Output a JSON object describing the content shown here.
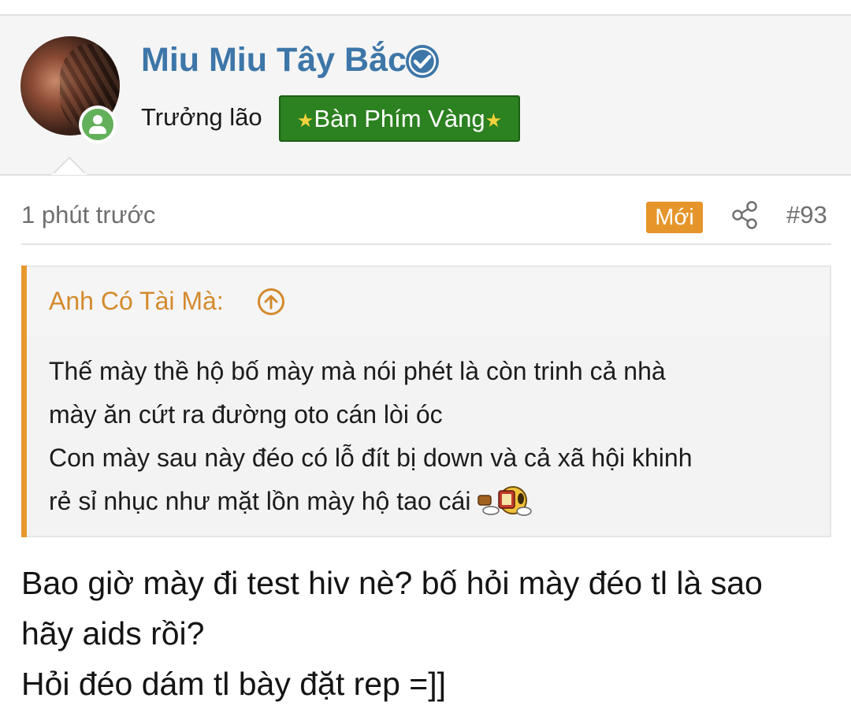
{
  "user": {
    "name": "Miu Miu Tây Bắc",
    "title": "Trưởng lão",
    "banner": "Bàn Phím Vàng",
    "banner_star": "★",
    "verified_icon": "verified-check-icon",
    "status_icon": "online-user-icon"
  },
  "post": {
    "time": "1 phút trước",
    "new_badge": "Mới",
    "share_icon": "share-icon",
    "number": "#93"
  },
  "quote": {
    "author": "Anh Có Tài Mà:",
    "lines": [
      "Thế mày thề hộ bố mày mà nói phét là còn trinh cả nhà",
      "mày ăn cứt ra đường oto cán lòi óc",
      "Con mày sau này đéo có lỗ đít bị down và cả xã hội khinh",
      "rẻ sỉ nhục như mặt lồn mày hộ tao cái"
    ],
    "emoji": "rage-smiley-emoji"
  },
  "message": {
    "lines": [
      "Bao giờ mày đi test hiv nè? bố hỏi mày đéo tl là sao",
      "hãy aids rồi?",
      "Hỏi đéo dám tl bày đặt rep =]]"
    ]
  },
  "colors": {
    "username": "#3d76a8",
    "banner_bg": "#2c8120",
    "new_badge": "#e5952a",
    "quote_accent": "#e6992e",
    "online": "#63b05b"
  }
}
